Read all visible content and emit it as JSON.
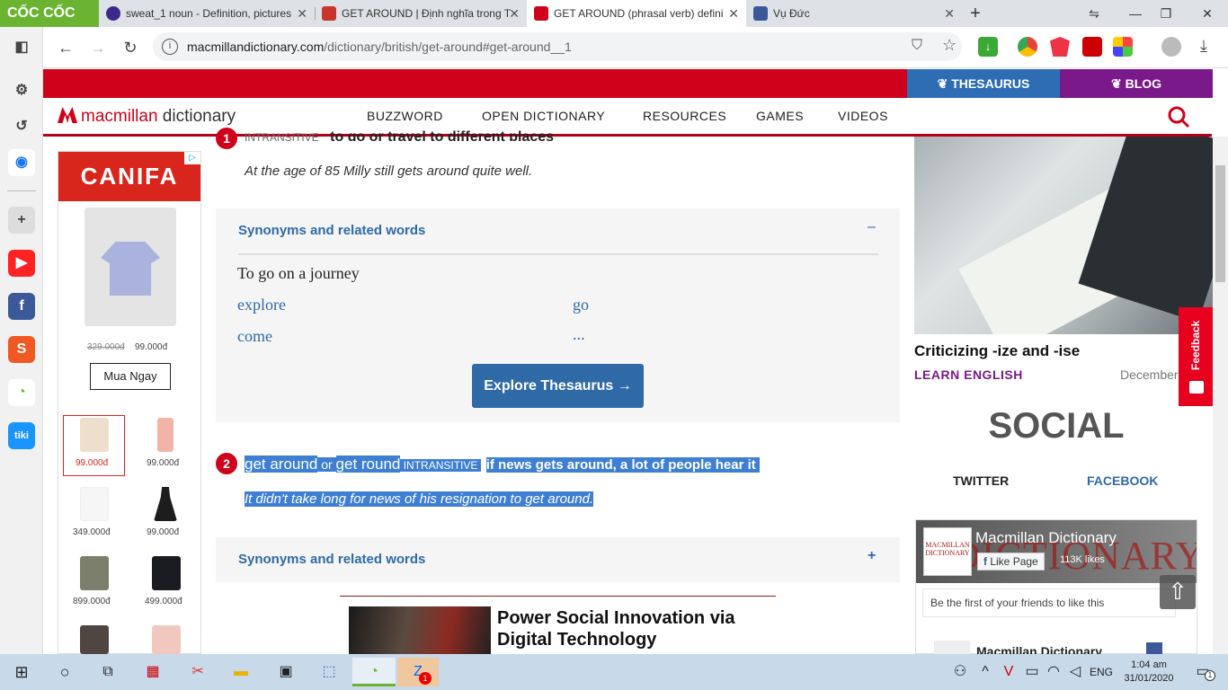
{
  "browser": {
    "logo": "CỐC CỐC",
    "tabs": [
      {
        "title": "sweat_1 noun - Definition, pictures"
      },
      {
        "title": "GET AROUND | Định nghĩa trong T"
      },
      {
        "title": "GET AROUND (phrasal verb) defini"
      },
      {
        "title": "Vụ Đức"
      }
    ],
    "new_tab": "+",
    "url_host": "macmillandictionary.com",
    "url_path": "/dictionary/british/get-around#get-around__1"
  },
  "site": {
    "thesaurus_link": "THESAURUS",
    "blog_link": "BLOG",
    "brand_primary": "macmillan",
    "brand_secondary": " dictionary",
    "nav": [
      "BUZZWORD",
      "OPEN DICTIONARY",
      "RESOURCES",
      "GAMES",
      "VIDEOS"
    ],
    "accent_red": "#d0021b"
  },
  "ad": {
    "brand": "CANIFA",
    "old_price": "329.000đ",
    "new_price": "99.000đ",
    "cta": "Mua Ngay",
    "items": [
      {
        "price": "99.000đ"
      },
      {
        "price": "99.000đ"
      },
      {
        "price": "349.000đ"
      },
      {
        "price": "99.000đ"
      },
      {
        "price": "899.000đ"
      },
      {
        "price": "499.000đ"
      }
    ]
  },
  "entry": {
    "sense1": {
      "number": "1",
      "grammar": "INTRANSITIVE",
      "definition": "to go or travel to different places",
      "example": "At the age of 85 Milly still gets around quite well."
    },
    "syn1": {
      "title": "Synonyms and related words",
      "toggle": "–",
      "group": "To go on a journey",
      "words": [
        "explore",
        "go",
        "come",
        "..."
      ],
      "button": "Explore Thesaurus →"
    },
    "sense2": {
      "number": "2",
      "headword1": "get around",
      "or": "or",
      "headword2": "get round",
      "grammar": "INTRANSITIVE",
      "definition": "if news gets around, a lot of people hear it",
      "example": "It didn't take long for news of his resignation to get around."
    },
    "syn2": {
      "title": "Synonyms and related words",
      "toggle": "+"
    },
    "promo_title_1": "Power Social Innovation via",
    "promo_title_2": "Digital Technology"
  },
  "sidebar": {
    "article_title": "Criticizing -ize and -ise",
    "article_category": "LEARN ENGLISH",
    "article_date": "December",
    "feedback": "Feedback",
    "social_heading": "SOCIAL",
    "social_tabs": [
      "TWITTER",
      "FACEBOOK"
    ],
    "fb_page_name": "Macmillan Dictionary",
    "fb_like": "Like Page",
    "fb_likes": "113K likes",
    "fb_friends": "Be the first of your friends to like this",
    "fb_post_name": "Macmillan Dictionary",
    "fb_logo_text": "MACMILLAN DICTIONARY",
    "fb_cover_text": "DICTIONARY"
  },
  "taskbar": {
    "lang": "ENG",
    "time": "1:04 am",
    "date": "31/01/2020",
    "notif_count": "1",
    "zalo_badge": "1"
  }
}
